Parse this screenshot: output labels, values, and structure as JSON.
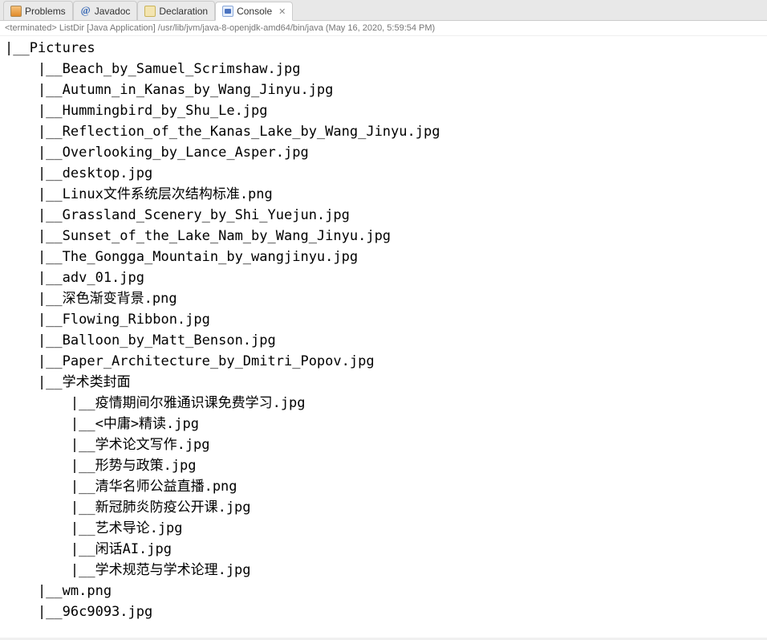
{
  "tabs": [
    {
      "label": "Problems",
      "iconClass": "icon-problems"
    },
    {
      "label": "Javadoc",
      "iconClass": "icon-javadoc",
      "iconText": "@"
    },
    {
      "label": "Declaration",
      "iconClass": "icon-declaration"
    },
    {
      "label": "Console",
      "iconClass": "icon-console",
      "active": true,
      "closable": true
    }
  ],
  "statusLine": "<terminated> ListDir [Java Application] /usr/lib/jvm/java-8-openjdk-amd64/bin/java (May 16, 2020, 5:59:54 PM)",
  "closeGlyph": "✕",
  "tree": {
    "name": "Pictures",
    "children": [
      {
        "name": "Beach_by_Samuel_Scrimshaw.jpg"
      },
      {
        "name": "Autumn_in_Kanas_by_Wang_Jinyu.jpg"
      },
      {
        "name": "Hummingbird_by_Shu_Le.jpg"
      },
      {
        "name": "Reflection_of_the_Kanas_Lake_by_Wang_Jinyu.jpg"
      },
      {
        "name": "Overlooking_by_Lance_Asper.jpg"
      },
      {
        "name": "desktop.jpg"
      },
      {
        "name": "Linux文件系统层次结构标准.png"
      },
      {
        "name": "Grassland_Scenery_by_Shi_Yuejun.jpg"
      },
      {
        "name": "Sunset_of_the_Lake_Nam_by_Wang_Jinyu.jpg"
      },
      {
        "name": "The_Gongga_Mountain_by_wangjinyu.jpg"
      },
      {
        "name": "adv_01.jpg"
      },
      {
        "name": "深色渐变背景.png"
      },
      {
        "name": "Flowing_Ribbon.jpg"
      },
      {
        "name": "Balloon_by_Matt_Benson.jpg"
      },
      {
        "name": "Paper_Architecture_by_Dmitri_Popov.jpg"
      },
      {
        "name": "学术类封面",
        "children": [
          {
            "name": "疫情期间尔雅通识课免费学习.jpg"
          },
          {
            "name": "<中庸>精读.jpg"
          },
          {
            "name": "学术论文写作.jpg"
          },
          {
            "name": "形势与政策.jpg"
          },
          {
            "name": "清华名师公益直播.png"
          },
          {
            "name": "新冠肺炎防疫公开课.jpg"
          },
          {
            "name": "艺术导论.jpg"
          },
          {
            "name": "闲话AI.jpg"
          },
          {
            "name": "学术规范与学术论理.jpg"
          }
        ]
      },
      {
        "name": "wm.png"
      },
      {
        "name": "96c9093.jpg"
      }
    ]
  }
}
